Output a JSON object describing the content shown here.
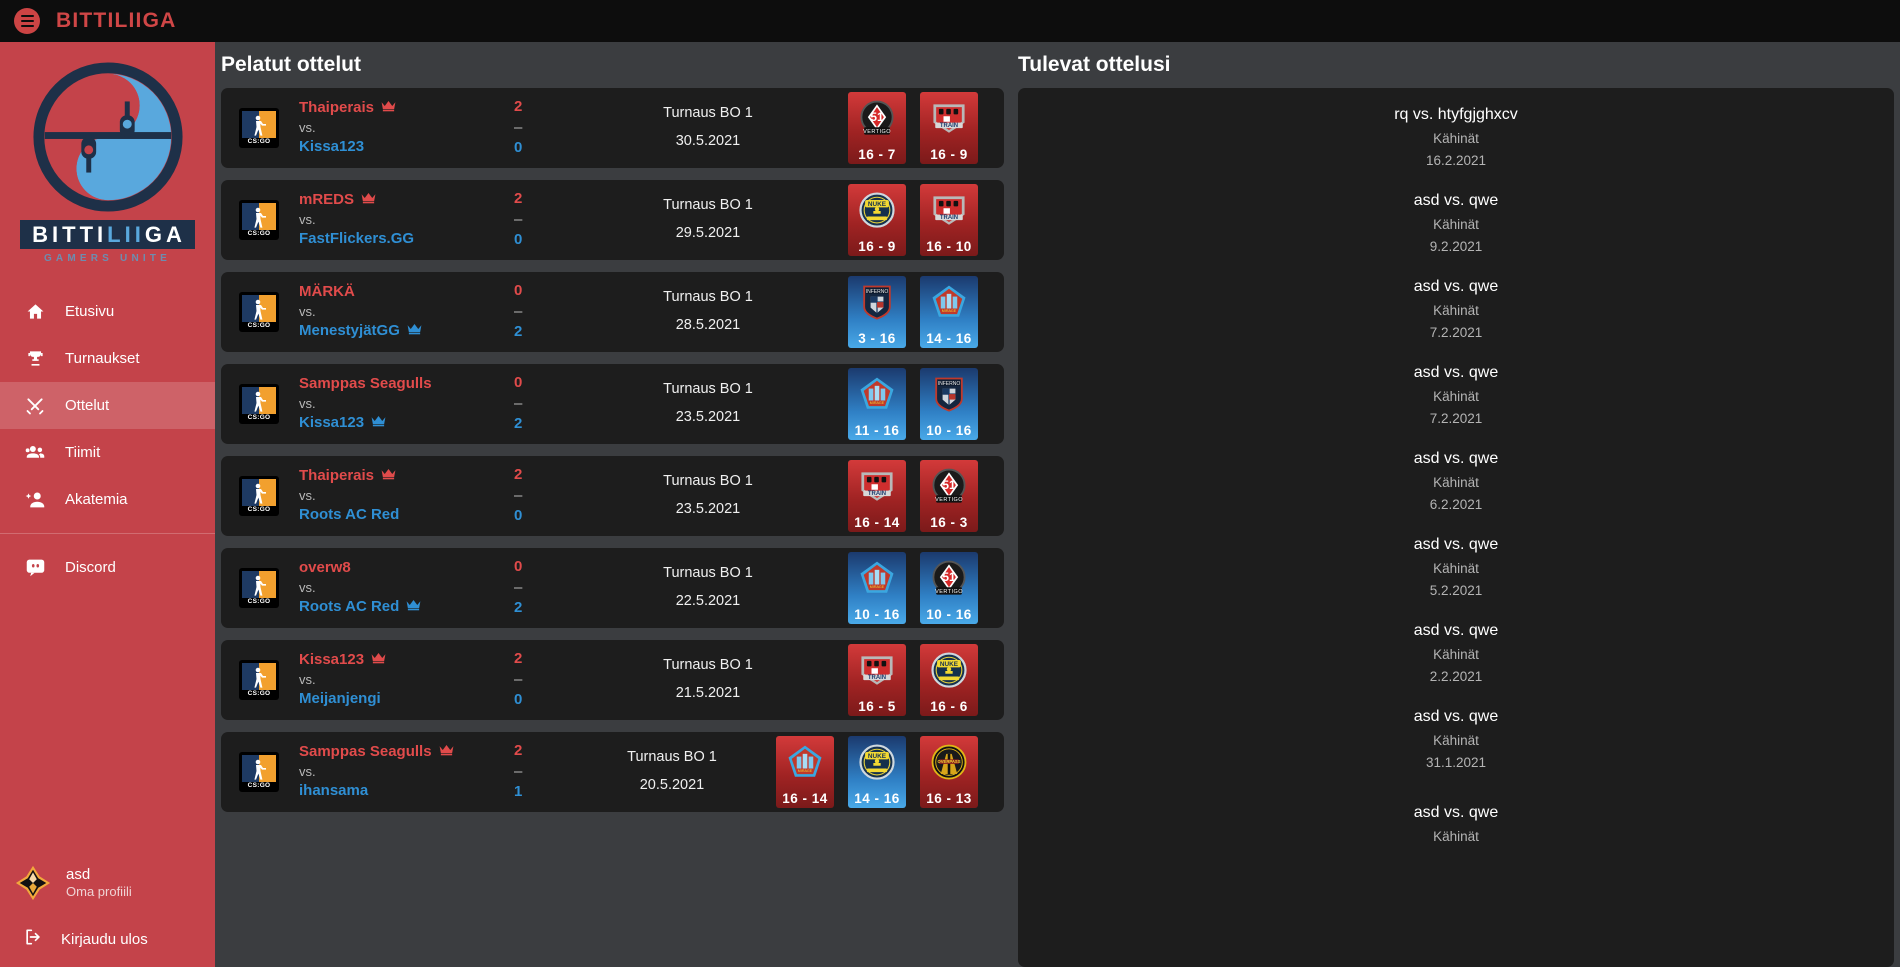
{
  "topbar": {
    "brand": "BITTILIIGA",
    "menu_icon": "hamburger-icon"
  },
  "sidebar": {
    "logo": {
      "word_1": "BITTI",
      "word_2": "LII",
      "word_3": "GA",
      "tagline": "GAMERS UNITE"
    },
    "items": [
      {
        "label": "Etusivu",
        "icon": "home-icon",
        "active": false
      },
      {
        "label": "Turnaukset",
        "icon": "trophy-icon",
        "active": false
      },
      {
        "label": "Ottelut",
        "icon": "swords-icon",
        "active": true
      },
      {
        "label": "Tiimit",
        "icon": "group-icon",
        "active": false
      },
      {
        "label": "Akatemia",
        "icon": "person-add-icon",
        "active": false
      },
      {
        "label": "Discord",
        "icon": "discord-icon",
        "active": false
      }
    ],
    "profile": {
      "name": "asd",
      "subtitle": "Oma profiili",
      "avatar": "diamond-avatar-icon"
    },
    "logout": {
      "label": "Kirjaudu ulos",
      "icon": "logout-icon"
    }
  },
  "main": {
    "title": "Pelatut ottelut",
    "vs_label": "vs.",
    "score_dash": "–",
    "game_icon": "csgo-icon",
    "crown_icon": "crown-icon",
    "matches": [
      {
        "team_a": "Thaiperais",
        "team_b": "Kissa123",
        "winner": "a",
        "score_a": "2",
        "score_b": "0",
        "tournament": "Turnaus BO 1",
        "date": "30.5.2021",
        "maps": [
          {
            "map": "vertigo",
            "score": "16 - 7",
            "result": "win"
          },
          {
            "map": "train",
            "score": "16 - 9",
            "result": "win"
          }
        ]
      },
      {
        "team_a": "mREDS",
        "team_b": "FastFlickers.GG",
        "winner": "a",
        "score_a": "2",
        "score_b": "0",
        "tournament": "Turnaus BO 1",
        "date": "29.5.2021",
        "maps": [
          {
            "map": "nuke",
            "score": "16 - 9",
            "result": "win"
          },
          {
            "map": "train",
            "score": "16 - 10",
            "result": "win"
          }
        ]
      },
      {
        "team_a": "MÄRKÄ",
        "team_b": "MenestyjätGG",
        "winner": "b",
        "score_a": "0",
        "score_b": "2",
        "tournament": "Turnaus BO 1",
        "date": "28.5.2021",
        "maps": [
          {
            "map": "inferno",
            "score": "3 - 16",
            "result": "loss"
          },
          {
            "map": "mirage",
            "score": "14 - 16",
            "result": "loss"
          }
        ]
      },
      {
        "team_a": "Samppas Seagulls",
        "team_b": "Kissa123",
        "winner": "b",
        "score_a": "0",
        "score_b": "2",
        "tournament": "Turnaus BO 1",
        "date": "23.5.2021",
        "maps": [
          {
            "map": "mirage",
            "score": "11 - 16",
            "result": "loss"
          },
          {
            "map": "inferno",
            "score": "10 - 16",
            "result": "loss"
          }
        ]
      },
      {
        "team_a": "Thaiperais",
        "team_b": "Roots AC Red",
        "winner": "a",
        "score_a": "2",
        "score_b": "0",
        "tournament": "Turnaus BO 1",
        "date": "23.5.2021",
        "maps": [
          {
            "map": "train",
            "score": "16 - 14",
            "result": "win"
          },
          {
            "map": "vertigo",
            "score": "16 - 3",
            "result": "win"
          }
        ]
      },
      {
        "team_a": "overw8",
        "team_b": "Roots AC Red",
        "winner": "b",
        "score_a": "0",
        "score_b": "2",
        "tournament": "Turnaus BO 1",
        "date": "22.5.2021",
        "maps": [
          {
            "map": "mirage",
            "score": "10 - 16",
            "result": "loss"
          },
          {
            "map": "vertigo",
            "score": "10 - 16",
            "result": "loss"
          }
        ]
      },
      {
        "team_a": "Kissa123",
        "team_b": "Meijanjengi",
        "winner": "a",
        "score_a": "2",
        "score_b": "0",
        "tournament": "Turnaus BO 1",
        "date": "21.5.2021",
        "maps": [
          {
            "map": "train",
            "score": "16 - 5",
            "result": "win"
          },
          {
            "map": "nuke",
            "score": "16 - 6",
            "result": "win"
          }
        ]
      },
      {
        "team_a": "Samppas Seagulls",
        "team_b": "ihansama",
        "winner": "a",
        "score_a": "2",
        "score_b": "1",
        "tournament": "Turnaus BO 1",
        "date": "20.5.2021",
        "maps": [
          {
            "map": "mirage",
            "score": "16 - 14",
            "result": "win"
          },
          {
            "map": "nuke",
            "score": "14 - 16",
            "result": "loss"
          },
          {
            "map": "overpass",
            "score": "16 - 13",
            "result": "win"
          }
        ]
      }
    ]
  },
  "upcoming": {
    "title": "Tulevat ottelusi",
    "items": [
      {
        "title": "rq vs. htyfgjghxcv",
        "tournament": "Kähinät",
        "date": "16.2.2021"
      },
      {
        "title": "asd vs. qwe",
        "tournament": "Kähinät",
        "date": "9.2.2021"
      },
      {
        "title": "asd vs. qwe",
        "tournament": "Kähinät",
        "date": "7.2.2021"
      },
      {
        "title": "asd vs. qwe",
        "tournament": "Kähinät",
        "date": "7.2.2021"
      },
      {
        "title": "asd vs. qwe",
        "tournament": "Kähinät",
        "date": "6.2.2021"
      },
      {
        "title": "asd vs. qwe",
        "tournament": "Kähinät",
        "date": "5.2.2021"
      },
      {
        "title": "asd vs. qwe",
        "tournament": "Kähinät",
        "date": "2.2.2021"
      },
      {
        "title": "asd vs. qwe",
        "tournament": "Kähinät",
        "date": "31.1.2021"
      },
      {
        "title": "asd vs. qwe",
        "tournament": "Kähinät",
        "date": ""
      }
    ]
  },
  "colors": {
    "brand_red": "#cf4646",
    "sidebar_red": "#c4434a",
    "team_a_red": "#e14b4b",
    "team_b_blue": "#2f8fd4",
    "panel_dark": "#1d1d1d",
    "page_gray": "#3b3d40"
  }
}
